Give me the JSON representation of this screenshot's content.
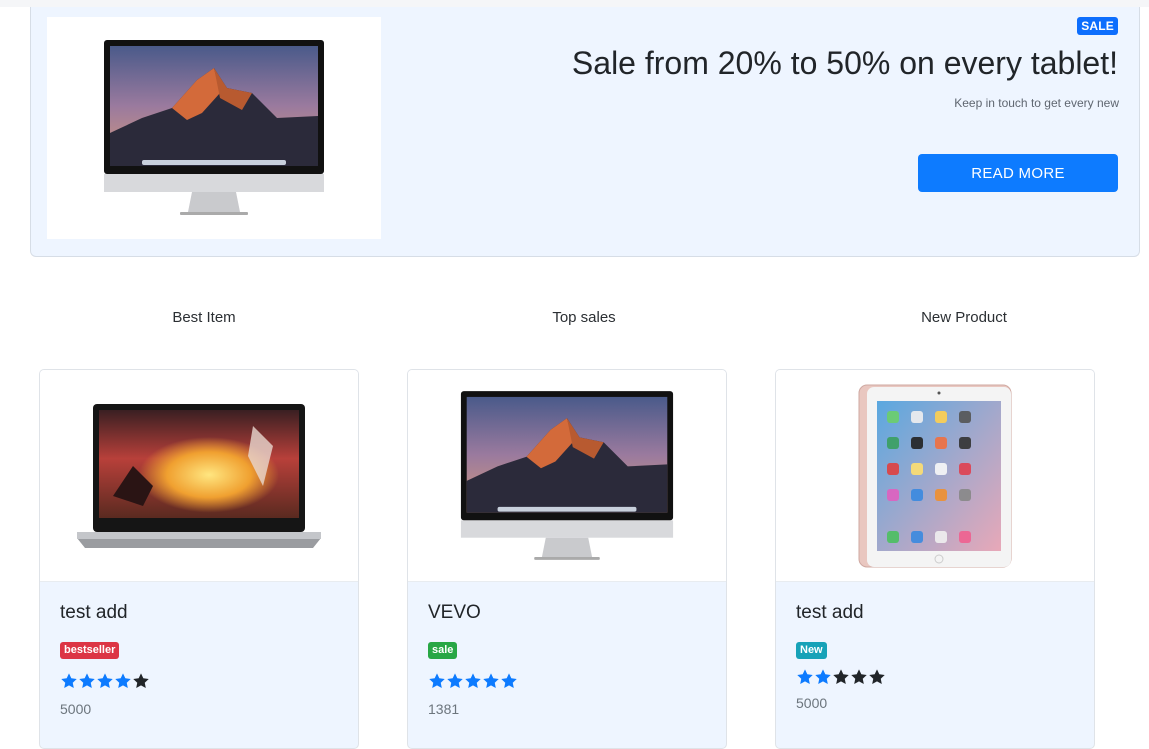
{
  "banner": {
    "badge": "SALE",
    "title": "Sale from 20% to 50% on every tablet!",
    "subtitle": "Keep in touch to get every new",
    "button_label": "READ MORE",
    "image": "imac-desktop-image"
  },
  "sections": [
    "Best Item",
    "Top sales",
    "New Product"
  ],
  "products": [
    {
      "title": "test add",
      "badge": "bestseller",
      "badge_color": "#dc3545",
      "rating": 4,
      "max_rating": 5,
      "price": "5000",
      "image": "laptop-image"
    },
    {
      "title": "VEVO",
      "badge": "sale",
      "badge_color": "#28a745",
      "rating": 5,
      "max_rating": 5,
      "price": "1381",
      "image": "imac-desktop-image"
    },
    {
      "title": "test add",
      "badge": "New",
      "badge_color": "#17a2b8",
      "rating": 2,
      "max_rating": 5,
      "price": "5000",
      "image": "ipad-tablet-image"
    }
  ],
  "colors": {
    "accent": "#0d7bff",
    "star_filled": "#0d7bff",
    "star_empty": "#212529",
    "card_bg": "#eef5ff"
  }
}
